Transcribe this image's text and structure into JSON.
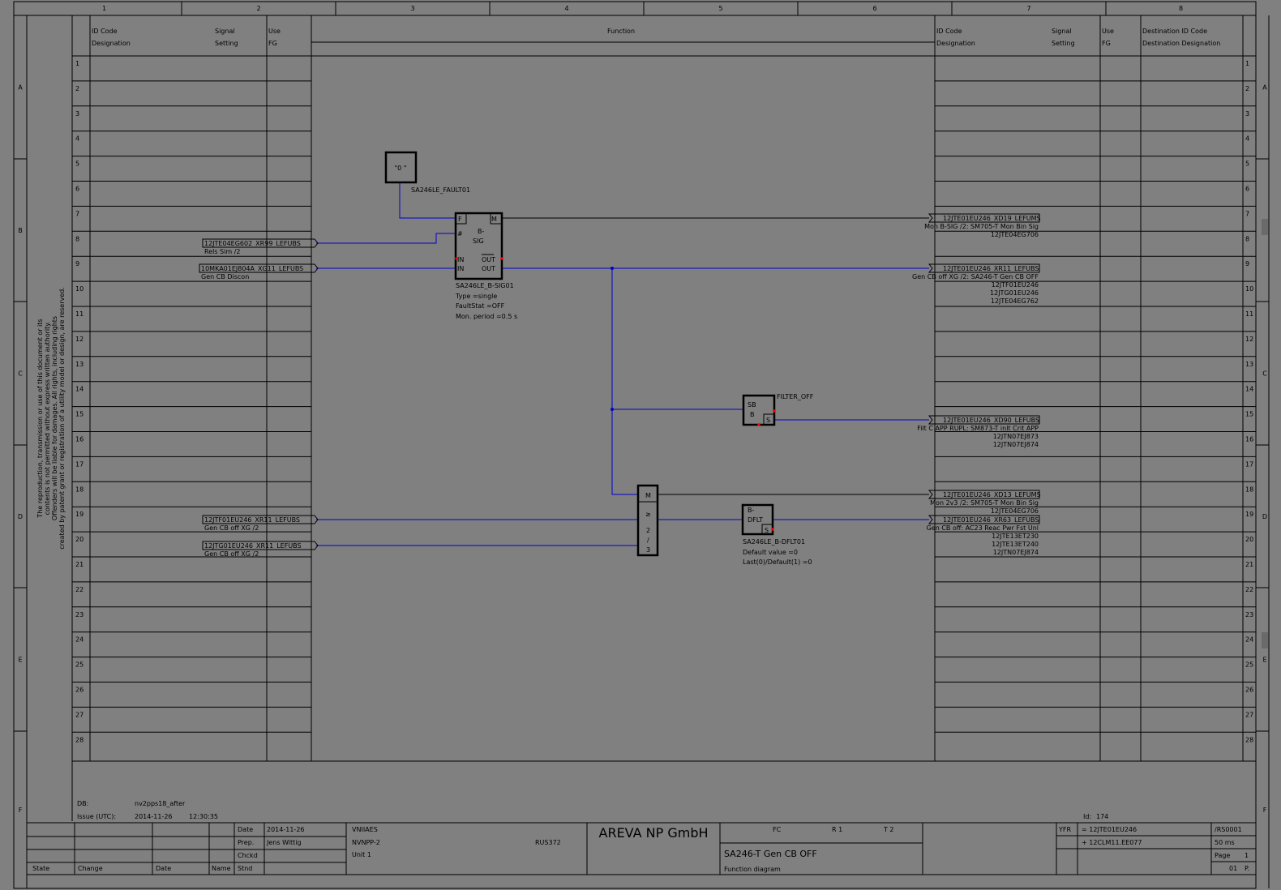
{
  "frame": {
    "columns": [
      "1",
      "2",
      "3",
      "4",
      "5",
      "6",
      "7",
      "8"
    ],
    "rows_side": [
      "A",
      "B",
      "C",
      "D",
      "E",
      "F"
    ],
    "line_numbers": [
      "1",
      "2",
      "3",
      "4",
      "5",
      "6",
      "7",
      "8",
      "9",
      "10",
      "11",
      "12",
      "13",
      "14",
      "15",
      "16",
      "17",
      "18",
      "19",
      "20",
      "21",
      "22",
      "23",
      "24",
      "25",
      "26",
      "27",
      "28"
    ],
    "copyright_lines": [
      "The reproduction, transmission or use of this document or its",
      "contents is not permitted without express written authority.",
      "Offenders will be liable for damages. All rights, including rights",
      "created by patent grant or registration of a utility model or design, are reserved."
    ]
  },
  "header": {
    "left": {
      "id_code": "ID Code",
      "designation": "Designation",
      "signal": "Signal",
      "setting": "Setting",
      "use": "Use",
      "fg": "FG"
    },
    "function": "Function",
    "right": {
      "id_code": "ID Code",
      "designation": "Designation",
      "signal": "Signal",
      "setting": "Setting",
      "use": "Use",
      "fg": "FG",
      "dest_id": "Destination ID Code",
      "dest_designation": "Destination Designation"
    }
  },
  "inputs": [
    {
      "tag": "12JTE04EG602_XR99_LEFUBS",
      "desc": "Rels Sim /2"
    },
    {
      "tag": "10MKA01EJ804A_XG11_LEFUBS",
      "desc": "Gen CB Discon"
    },
    {
      "tag": "12JTF01EU246_XR11_LEFUBS",
      "desc": "Gen CB off XG /2"
    },
    {
      "tag": "12JTG01EU246_XR11_LEFUBS",
      "desc": "Gen CB off XG /2"
    }
  ],
  "outputs": [
    {
      "tag": "12JTE01EU246_XD19_LEFUMS",
      "desc": "Mon B-SIG /2: SM705-T Mon Bin Sig",
      "dest": [
        "12JTE04EG706"
      ]
    },
    {
      "tag": "12JTE01EU246_XR11_LEFUBS",
      "desc": "Gen CB off XG /2: SA246-T Gen CB OFF",
      "dest": [
        "12JTF01EU246",
        "12JTG01EU246",
        "12JTE04EG762"
      ]
    },
    {
      "tag": "12JTE01EU246_XD90_LEFUBS",
      "desc": "Filt C APP RUPL: SM873-T inlt Crit APP",
      "dest": [
        "12JTN07EJ873",
        "12JTN07EJ874"
      ]
    },
    {
      "tag": "12JTE01EU246_XD13_LEFUMS",
      "desc": "Mon 2v3 /2: SM705-T Mon Bin Sig",
      "dest": [
        "12JTE04EG706"
      ]
    },
    {
      "tag": "12JTE01EU246_XR63_LEFUBS",
      "desc": "Gen CB off: AC23 Reac Pwr Fst Unl",
      "dest": [
        "12JTE13ET230",
        "12JTE13ET240",
        "12JTN07EJ874"
      ]
    }
  ],
  "blocks": {
    "const": {
      "label": "\"0  \"",
      "name": "SA246LE_FAULT01"
    },
    "bsig": {
      "title_1": "B-",
      "title_2": "SIG",
      "pin_f": "F",
      "pin_m": "M",
      "pin_hash": "#",
      "pin_in1": "IN",
      "pin_in2": "IN",
      "pin_out1": "OUT",
      "pin_out2": "OUT",
      "name": "SA246LE_B-SIG01",
      "param1": "Type =single",
      "param2": "FaultStat =OFF",
      "param3": "Mon. period =0.5 s"
    },
    "sbb": {
      "line1": "SB",
      "line2": "B",
      "pin_s": "S",
      "name": "FILTER_OFF"
    },
    "vote": {
      "pin_m": "M",
      "l1": "≥",
      "l2": "2",
      "l3": "/",
      "l4": "3"
    },
    "dflt": {
      "line1": "B-",
      "line2": "DFLT",
      "pin_s": "S",
      "name": "SA246LE_B-DFLT01",
      "param1": "Default value =0",
      "param2": "Last(0)/Default(1) =0"
    }
  },
  "footer": {
    "db_label": "DB:",
    "db_value": "nv2pps18_after",
    "issue_label": "Issue (UTC):",
    "issue_date": "2014-11-26",
    "issue_time": "12:30:35",
    "id_label": "Id:",
    "id_value": "174",
    "date_label": "Date",
    "date_value": "2014-11-26",
    "prep_label": "Prep.",
    "prep_value": "Jens Wittig",
    "chckd_label": "Chckd",
    "stnd_label": "Stnd",
    "org": "VNIIAES",
    "project": "NVNPP-2",
    "unit": "Unit 1",
    "rus": "RUS372",
    "company": "AREVA NP GmbH",
    "fc_label": "FC",
    "r_label": "R  1",
    "t_label": "T  2",
    "title": "SA246-T Gen CB OFF",
    "subtitle": "Function diagram",
    "yfr_label": "YFR",
    "yfr_value1": "= 12JTE01EU246",
    "yfr_value2": "+ 12CLM11.EE077",
    "rs": "/RS0001",
    "ms": "50 ms",
    "page_label": "Page",
    "page_value": "1",
    "p_value": "01",
    "p_label": "P.",
    "state": "State",
    "change": "Change",
    "date2": "Date",
    "name": "Name"
  }
}
